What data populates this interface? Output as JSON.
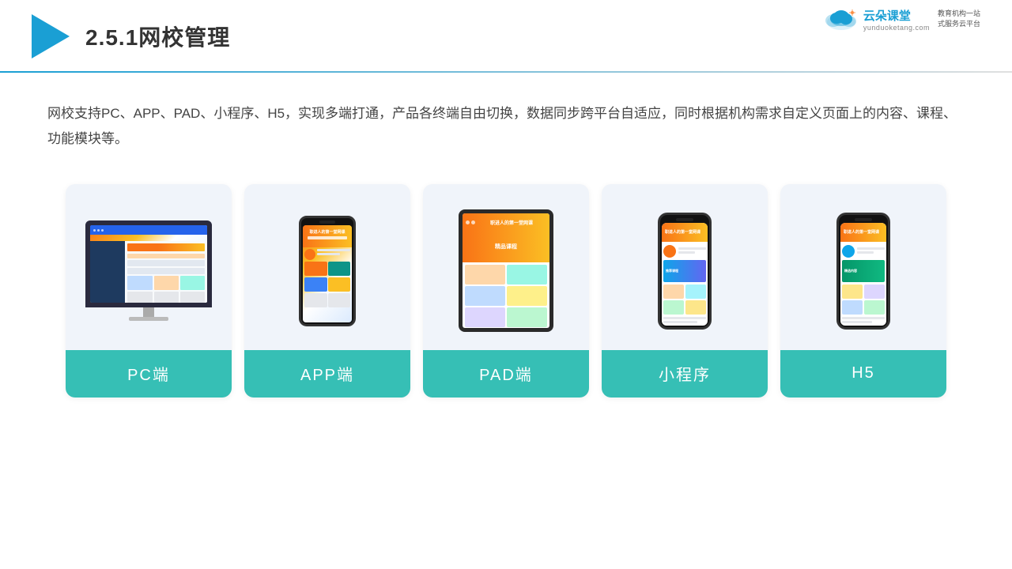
{
  "header": {
    "section_number": "2.5.1",
    "title": "网校管理",
    "brand": {
      "name": "云朵课堂",
      "url": "yunduoketang.com",
      "tagline": "教育机构一站\n式服务云平台"
    }
  },
  "description": "网校支持PC、APP、PAD、小程序、H5，实现多端打通，产品各终端自由切换，数据同步跨平台自适应，同时根据机构需求自定义页面上的内容、课程、功能模块等。",
  "cards": [
    {
      "id": "pc",
      "label": "PC端",
      "device": "monitor"
    },
    {
      "id": "app",
      "label": "APP端",
      "device": "phone"
    },
    {
      "id": "pad",
      "label": "PAD端",
      "device": "tablet"
    },
    {
      "id": "miniprogram",
      "label": "小程序",
      "device": "phone-tall"
    },
    {
      "id": "h5",
      "label": "H5",
      "device": "phone-tall"
    }
  ]
}
